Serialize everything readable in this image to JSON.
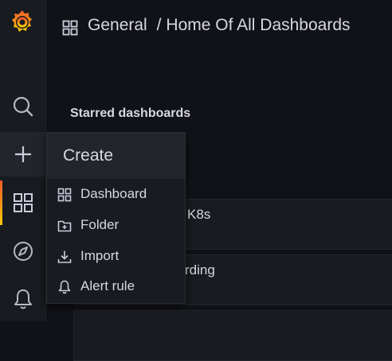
{
  "breadcrumb": {
    "folder": "General",
    "separator": "/",
    "dashboard": "Home Of All Dashboards"
  },
  "sidebar": {
    "items": [
      {
        "icon": "grafana-logo-icon"
      },
      {
        "icon": "search-icon"
      },
      {
        "icon": "plus-icon"
      },
      {
        "icon": "dashboards-grid-icon"
      },
      {
        "icon": "compass-icon"
      },
      {
        "icon": "bell-icon"
      }
    ]
  },
  "main": {
    "section_title": "Starred dashboards",
    "rows": [
      {
        "visible_text": "K8s"
      },
      {
        "visible_text": "rding"
      }
    ]
  },
  "create_menu": {
    "header": "Create",
    "items": [
      {
        "label": "Dashboard",
        "icon": "apps-grid-icon"
      },
      {
        "label": "Folder",
        "icon": "folder-plus-icon"
      },
      {
        "label": "Import",
        "icon": "import-icon"
      },
      {
        "label": "Alert rule",
        "icon": "bell-icon"
      }
    ]
  },
  "colors": {
    "background": "#111217",
    "panel": "#181b1f",
    "text": "#ccccdc",
    "accent_start": "#f05a28",
    "accent_end": "#fbca0a"
  }
}
